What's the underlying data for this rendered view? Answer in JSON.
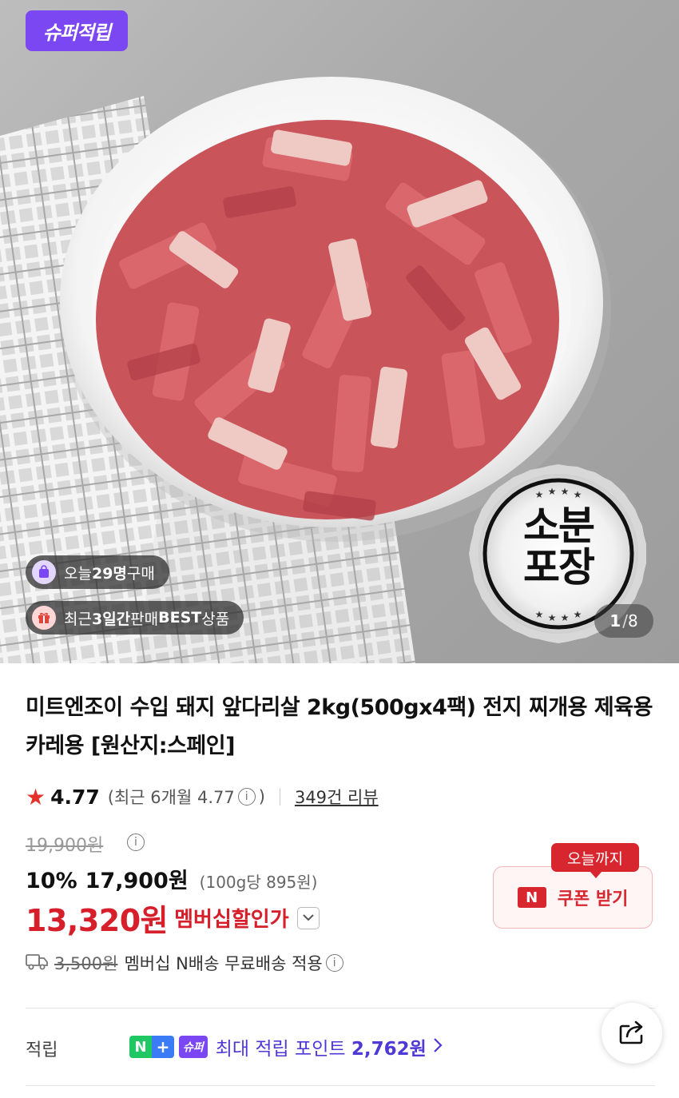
{
  "hero": {
    "super_badge": "슈퍼적립",
    "today_purchase": {
      "prefix": "오늘 ",
      "count": "29명",
      "suffix": " 구매"
    },
    "best_badge": {
      "prefix": "최근 ",
      "days": "3일간",
      "middle": " 판매 ",
      "best": "BEST",
      "suffix": " 상품"
    },
    "seal_line1": "소분",
    "seal_line2": "포장",
    "pager_current": "1",
    "pager_total": "8"
  },
  "product": {
    "title": "미트엔조이 수입 돼지 앞다리살 2kg(500gx4팩) 전지 찌개용 제육용 카레용 [원산지:스페인]",
    "rating": "4.77",
    "rating_recent": "(최근 6개월 4.77",
    "rating_recent_close": ")",
    "review_count": "349건 리뷰",
    "original_price": "19,900원",
    "discount_pct": "10%",
    "sale_price": "17,900원",
    "unit_price": "(100g당 895원)",
    "member_price": "13,320원",
    "member_label": "멤버십할인가",
    "coupon_tag": "오늘까지",
    "coupon_label": "쿠폰 받기",
    "coupon_icon": "N",
    "shipping_fee": "3,500원",
    "shipping_text": "멤버십 N배송 무료배송 적용"
  },
  "points": {
    "label": "적립",
    "n_icon": "N",
    "plus_icon": "+",
    "super_icon": "슈퍼",
    "prefix": "최대 적립 포인트 ",
    "amount": "2,762원"
  },
  "colors": {
    "accent_purple": "#7b47f2",
    "price_red": "#d61f2a",
    "point_blue": "#4f39d6",
    "star": "#e4322b"
  },
  "icons": [
    "shopping-bag-icon",
    "gift-icon",
    "star-icon",
    "info-icon",
    "chevron-down-icon",
    "truck-icon",
    "chevron-right-icon",
    "share-icon"
  ]
}
